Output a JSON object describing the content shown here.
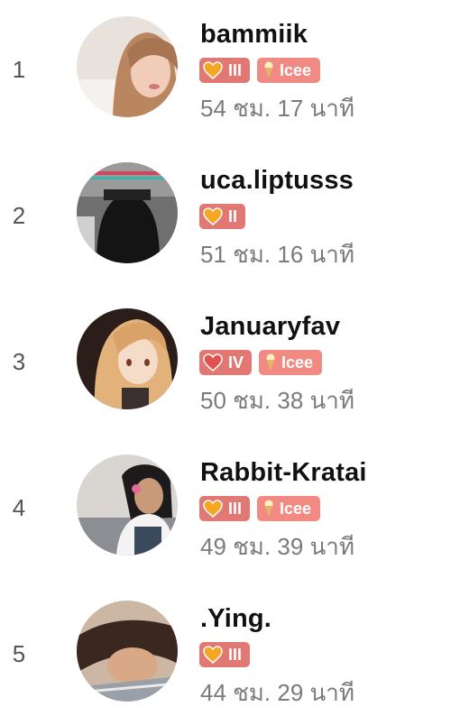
{
  "leaderboard": [
    {
      "rank": "1",
      "username": "bammiik",
      "level": "III",
      "tag": "Icee",
      "time": "54 ชม. 17 นาที"
    },
    {
      "rank": "2",
      "username": "uca.liptusss",
      "level": "II",
      "tag": null,
      "time": "51 ชม. 16 นาที"
    },
    {
      "rank": "3",
      "username": "Januaryfav",
      "level": "IV",
      "tag": "Icee",
      "time": "50 ชม. 38 นาที"
    },
    {
      "rank": "4",
      "username": "Rabbit-Kratai",
      "level": "III",
      "tag": "Icee",
      "time": "49 ชม. 39 นาที"
    },
    {
      "rank": "5",
      "username": ".Ying.",
      "level": "III",
      "tag": null,
      "time": "44 ชม. 29 นาที"
    }
  ],
  "colors": {
    "level_badge": "#e27873",
    "tag_badge": "#f08a82",
    "username": "#111111",
    "time": "#7b7b7b",
    "rank": "#555555"
  },
  "icons": {
    "level": "heart-icon",
    "tag": "ice-cream-icon"
  }
}
